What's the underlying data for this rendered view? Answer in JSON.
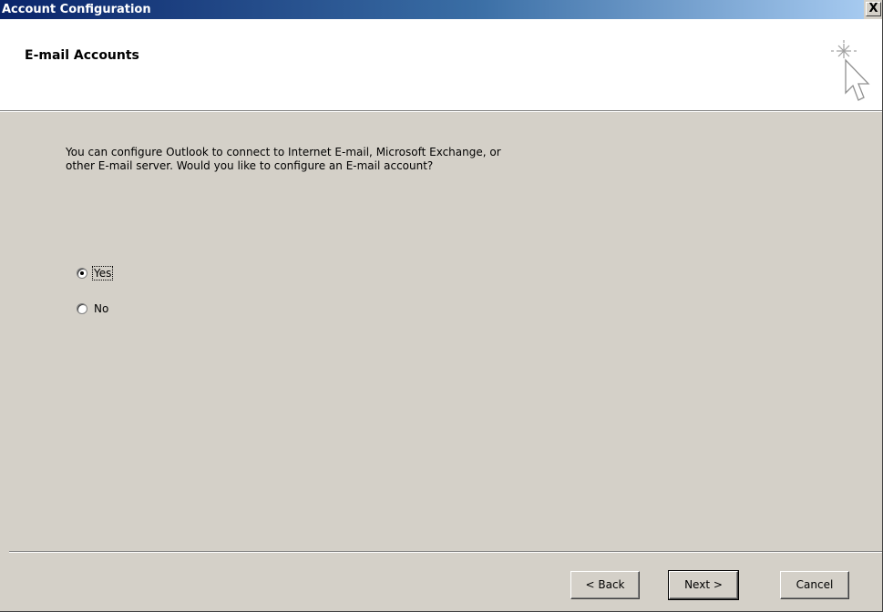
{
  "window": {
    "title": "Account Configuration",
    "close_label": "X"
  },
  "header": {
    "title": "E-mail Accounts",
    "icon": "wizard-cursor-sparkle-icon"
  },
  "body": {
    "prompt_line1": "You can configure Outlook to connect to Internet E-mail, Microsoft Exchange, or",
    "prompt_line2": "other E-mail server. Would you like to configure an E-mail account?"
  },
  "options": [
    {
      "label": "Yes",
      "selected": true
    },
    {
      "label": "No",
      "selected": false
    }
  ],
  "buttons": {
    "back": "< Back",
    "next": "Next >",
    "cancel": "Cancel"
  }
}
